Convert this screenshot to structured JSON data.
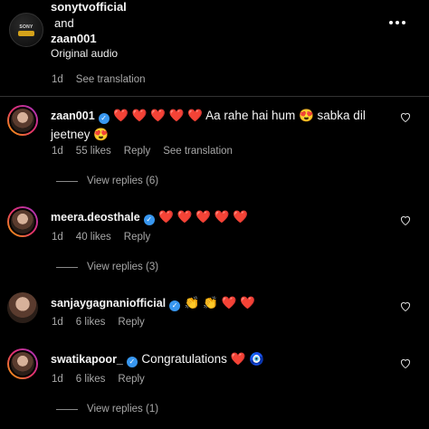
{
  "header": {
    "account1": "sonytvofficial",
    "connector": "and",
    "account2": "zaan001",
    "audio": "Original audio",
    "logo_text": "SONY"
  },
  "top_meta": {
    "time": "1d",
    "translate": "See translation"
  },
  "comments": [
    {
      "username": "zaan001",
      "verified": true,
      "text_line1": "❤️ ❤️ ❤️ ❤️ ❤️ Aa rahe hai hum 😍 sabka dil",
      "text_line2": "jeetney 😍",
      "time": "1d",
      "likes": "55 likes",
      "reply": "Reply",
      "translate": "See translation",
      "view_replies": "View replies (6)"
    },
    {
      "username": "meera.deosthale",
      "verified": true,
      "text_line1": "❤️ ❤️ ❤️ ❤️ ❤️",
      "time": "1d",
      "likes": "40 likes",
      "reply": "Reply",
      "view_replies": "View replies (3)"
    },
    {
      "username": "sanjaygagnaniofficial",
      "verified": true,
      "text_line1": "👏 👏 ❤️ ❤️",
      "time": "1d",
      "likes": "6 likes",
      "reply": "Reply"
    },
    {
      "username": "swatikapoor_",
      "verified": true,
      "text_line1": "Congratulations ❤️ 🧿",
      "time": "1d",
      "likes": "6 likes",
      "reply": "Reply",
      "view_replies": "View replies (1)"
    }
  ]
}
